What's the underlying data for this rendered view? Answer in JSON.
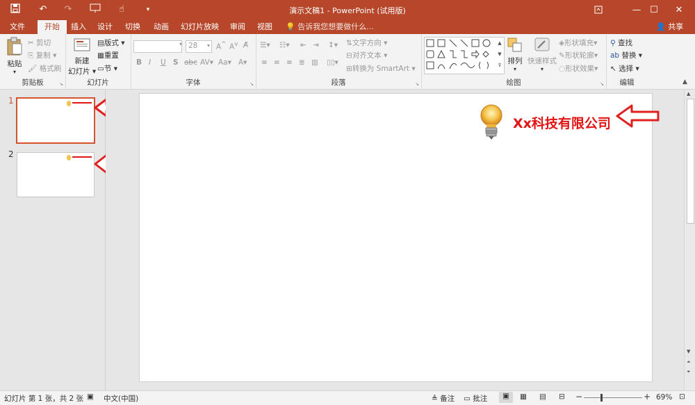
{
  "titlebar": {
    "title": "演示文稿1 - PowerPoint (试用版)"
  },
  "tabs": [
    "文件",
    "开始",
    "插入",
    "设计",
    "切换",
    "动画",
    "幻灯片放映",
    "审阅",
    "视图"
  ],
  "tellme": "告诉我您想要做什么...",
  "share": "共享",
  "ribbon": {
    "clipboard": {
      "paste": "粘贴",
      "cut": "剪切",
      "copy": "复制",
      "format_painter": "格式刷",
      "label": "剪贴板"
    },
    "slides": {
      "new_slide_1": "新建",
      "new_slide_2": "幻灯片",
      "layout": "版式",
      "reset": "重置",
      "section": "节",
      "label": "幻灯片"
    },
    "font": {
      "font_size": "28",
      "label": "字体"
    },
    "paragraph": {
      "text_direction": "文字方向",
      "align_text": "对齐文本",
      "smartart": "转换为 SmartArt",
      "label": "段落"
    },
    "drawing": {
      "arrange": "排列",
      "quick_styles": "快速样式",
      "shape_fill": "形状填充",
      "shape_outline": "形状轮廓",
      "shape_effects": "形状效果",
      "label": "绘图"
    },
    "editing": {
      "find": "查找",
      "replace": "替换",
      "select": "选择",
      "label": "编辑"
    }
  },
  "thumbnails": [
    {
      "number": "1",
      "selected": true
    },
    {
      "number": "2",
      "selected": false
    }
  ],
  "slide": {
    "company": "Xx科技有限公司"
  },
  "statusbar": {
    "slide_info": "幻灯片 第 1 张，共 2 张",
    "language": "中文(中国)",
    "notes": "备注",
    "comments": "批注",
    "zoom": "69%"
  },
  "colors": {
    "accent": "#b7472a",
    "annotation_arrow": "#e02020",
    "company_text": "#e31414"
  }
}
